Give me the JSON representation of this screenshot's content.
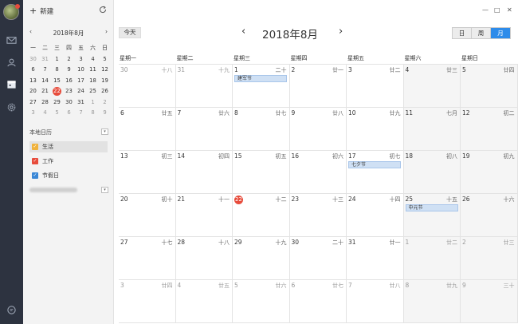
{
  "sidebar": {
    "new_label": "新建",
    "mini_title": "2018年8月",
    "prev": "‹",
    "next": "›",
    "weekdays": [
      "一",
      "二",
      "三",
      "四",
      "五",
      "六",
      "日"
    ],
    "weeks": [
      [
        {
          "t": "30",
          "dim": true
        },
        {
          "t": "31",
          "dim": true
        },
        {
          "t": "1"
        },
        {
          "t": "2"
        },
        {
          "t": "3"
        },
        {
          "t": "4"
        },
        {
          "t": "5"
        }
      ],
      [
        {
          "t": "6"
        },
        {
          "t": "7"
        },
        {
          "t": "8"
        },
        {
          "t": "9"
        },
        {
          "t": "10"
        },
        {
          "t": "11"
        },
        {
          "t": "12"
        }
      ],
      [
        {
          "t": "13"
        },
        {
          "t": "14"
        },
        {
          "t": "15"
        },
        {
          "t": "16"
        },
        {
          "t": "17"
        },
        {
          "t": "18"
        },
        {
          "t": "19"
        }
      ],
      [
        {
          "t": "20"
        },
        {
          "t": "21"
        },
        {
          "t": "22",
          "today": true
        },
        {
          "t": "23"
        },
        {
          "t": "24"
        },
        {
          "t": "25"
        },
        {
          "t": "26"
        }
      ],
      [
        {
          "t": "27"
        },
        {
          "t": "28"
        },
        {
          "t": "29"
        },
        {
          "t": "30"
        },
        {
          "t": "31"
        },
        {
          "t": "1",
          "dim": true
        },
        {
          "t": "2",
          "dim": true
        }
      ],
      [
        {
          "t": "3",
          "dim": true
        },
        {
          "t": "4",
          "dim": true
        },
        {
          "t": "5",
          "dim": true
        },
        {
          "t": "6",
          "dim": true
        },
        {
          "t": "7",
          "dim": true
        },
        {
          "t": "8",
          "dim": true
        },
        {
          "t": "9",
          "dim": true
        }
      ]
    ],
    "local_calendars_title": "本地日历",
    "calendars": [
      {
        "label": "生活",
        "color": "#f0b23c",
        "selected": true
      },
      {
        "label": "工作",
        "color": "#e74c3c",
        "selected": false
      },
      {
        "label": "节假日",
        "color": "#3a87d6",
        "selected": false
      }
    ]
  },
  "window": {
    "minimize": "—",
    "maximize": "□",
    "close": "✕"
  },
  "toolbar": {
    "today_label": "今天",
    "prev": "‹",
    "next": "›",
    "month_title": "2018年8月",
    "views": [
      {
        "label": "日"
      },
      {
        "label": "周"
      },
      {
        "label": "月",
        "active": true
      }
    ]
  },
  "weekdays": [
    "星期一",
    "星期二",
    "星期三",
    "星期四",
    "星期五",
    "星期六",
    "星期日"
  ],
  "weeks": [
    [
      {
        "d": "30",
        "l": "十八",
        "other": true
      },
      {
        "d": "31",
        "l": "十九",
        "other": true
      },
      {
        "d": "1",
        "l": "二十",
        "event": "建军节"
      },
      {
        "d": "2",
        "l": "廿一"
      },
      {
        "d": "3",
        "l": "廿二"
      },
      {
        "d": "4",
        "l": "廿三"
      },
      {
        "d": "5",
        "l": "廿四"
      }
    ],
    [
      {
        "d": "6",
        "l": "廿五"
      },
      {
        "d": "7",
        "l": "廿六"
      },
      {
        "d": "8",
        "l": "廿七"
      },
      {
        "d": "9",
        "l": "廿八"
      },
      {
        "d": "10",
        "l": "廿九"
      },
      {
        "d": "11",
        "l": "七月"
      },
      {
        "d": "12",
        "l": "初二"
      }
    ],
    [
      {
        "d": "13",
        "l": "初三"
      },
      {
        "d": "14",
        "l": "初四"
      },
      {
        "d": "15",
        "l": "初五"
      },
      {
        "d": "16",
        "l": "初六"
      },
      {
        "d": "17",
        "l": "初七",
        "event": "七夕节"
      },
      {
        "d": "18",
        "l": "初八"
      },
      {
        "d": "19",
        "l": "初九"
      }
    ],
    [
      {
        "d": "20",
        "l": "初十"
      },
      {
        "d": "21",
        "l": "十一"
      },
      {
        "d": "22",
        "l": "十二",
        "today": true
      },
      {
        "d": "23",
        "l": "十三"
      },
      {
        "d": "24",
        "l": "十四"
      },
      {
        "d": "25",
        "l": "十五",
        "event": "中元节"
      },
      {
        "d": "26",
        "l": "十六"
      }
    ],
    [
      {
        "d": "27",
        "l": "十七"
      },
      {
        "d": "28",
        "l": "十八"
      },
      {
        "d": "29",
        "l": "十九"
      },
      {
        "d": "30",
        "l": "二十"
      },
      {
        "d": "31",
        "l": "廿一"
      },
      {
        "d": "1",
        "l": "廿二",
        "other": true
      },
      {
        "d": "2",
        "l": "廿三",
        "other": true
      }
    ],
    [
      {
        "d": "3",
        "l": "廿四",
        "other": true
      },
      {
        "d": "4",
        "l": "廿五",
        "other": true
      },
      {
        "d": "5",
        "l": "廿六",
        "other": true
      },
      {
        "d": "6",
        "l": "廿七",
        "other": true
      },
      {
        "d": "7",
        "l": "廿八",
        "other": true
      },
      {
        "d": "8",
        "l": "廿九",
        "other": true
      },
      {
        "d": "9",
        "l": "三十",
        "other": true
      }
    ]
  ]
}
